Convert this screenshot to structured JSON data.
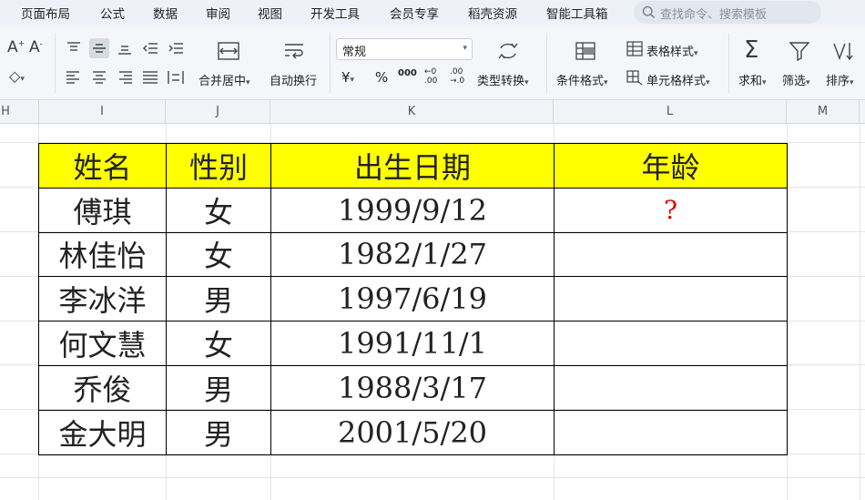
{
  "menu": {
    "items": [
      "页面布局",
      "公式",
      "数据",
      "审阅",
      "视图",
      "开发工具",
      "会员专享",
      "稻壳资源",
      "智能工具箱"
    ],
    "search_placeholder": "查找命令、搜索模板"
  },
  "ribbon": {
    "merge_center": "合并居中",
    "wrap_text": "自动换行",
    "number_format": "常规",
    "currency_symbol": "¥",
    "percent_symbol": "%",
    "thousands_symbol": "000",
    "type_convert": "类型转换",
    "conditional_format": "条件格式",
    "table_style": "表格样式",
    "cell_style": "单元格样式",
    "sum": "求和",
    "filter": "筛选",
    "sort": "排序"
  },
  "columns": [
    "H",
    "I",
    "J",
    "K",
    "L",
    "M"
  ],
  "table": {
    "headers": [
      "姓名",
      "性别",
      "出生日期",
      "年龄"
    ],
    "rows": [
      {
        "name": "傅琪",
        "gender": "女",
        "birth": "1999/9/12",
        "age": "?"
      },
      {
        "name": "林佳怡",
        "gender": "女",
        "birth": "1982/1/27",
        "age": ""
      },
      {
        "name": "李冰洋",
        "gender": "男",
        "birth": "1997/6/19",
        "age": ""
      },
      {
        "name": "何文慧",
        "gender": "女",
        "birth": "1991/11/1",
        "age": ""
      },
      {
        "name": "乔俊",
        "gender": "男",
        "birth": "1988/3/17",
        "age": ""
      },
      {
        "name": "金大明",
        "gender": "男",
        "birth": "2001/5/20",
        "age": ""
      }
    ]
  },
  "colors": {
    "header_fill": "#ffff00",
    "age_mark": "#e00000"
  }
}
